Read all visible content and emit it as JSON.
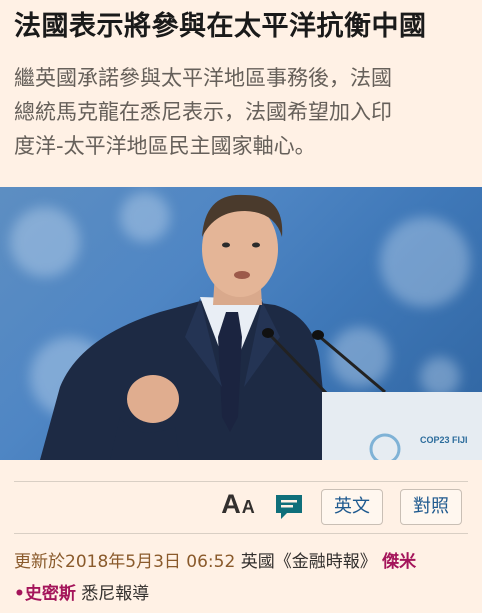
{
  "article": {
    "headline": "法國表示將參與在太平洋抗衡中國",
    "standfirst_lines": [
      "繼英國承諾參與太平洋地區事務後，法國",
      "總統馬克龍在悉尼表示，法國希望加入印",
      "度洋-太平洋地區民主國家軸心。"
    ],
    "image": {
      "signage_text": "COP23 FIJI"
    }
  },
  "toolbar": {
    "font_size_big": "A",
    "font_size_small": "A",
    "english_label": "英文",
    "bilingual_label": "對照"
  },
  "byline": {
    "updated_prefix": "更新於",
    "datetime": "2018年5月3日 06:52",
    "source": "英國《金融時報》",
    "author_part1": "傑米",
    "author_part2": "•史密斯",
    "location_report": "悉尼報導"
  },
  "colors": {
    "background": "#fff1e5",
    "headline": "#1a1a1a",
    "standfirst": "#66605a",
    "date": "#8a5a2b",
    "author": "#a4145a",
    "link_blue": "#1f5a8f",
    "comment_teal": "#0f6f7a"
  }
}
